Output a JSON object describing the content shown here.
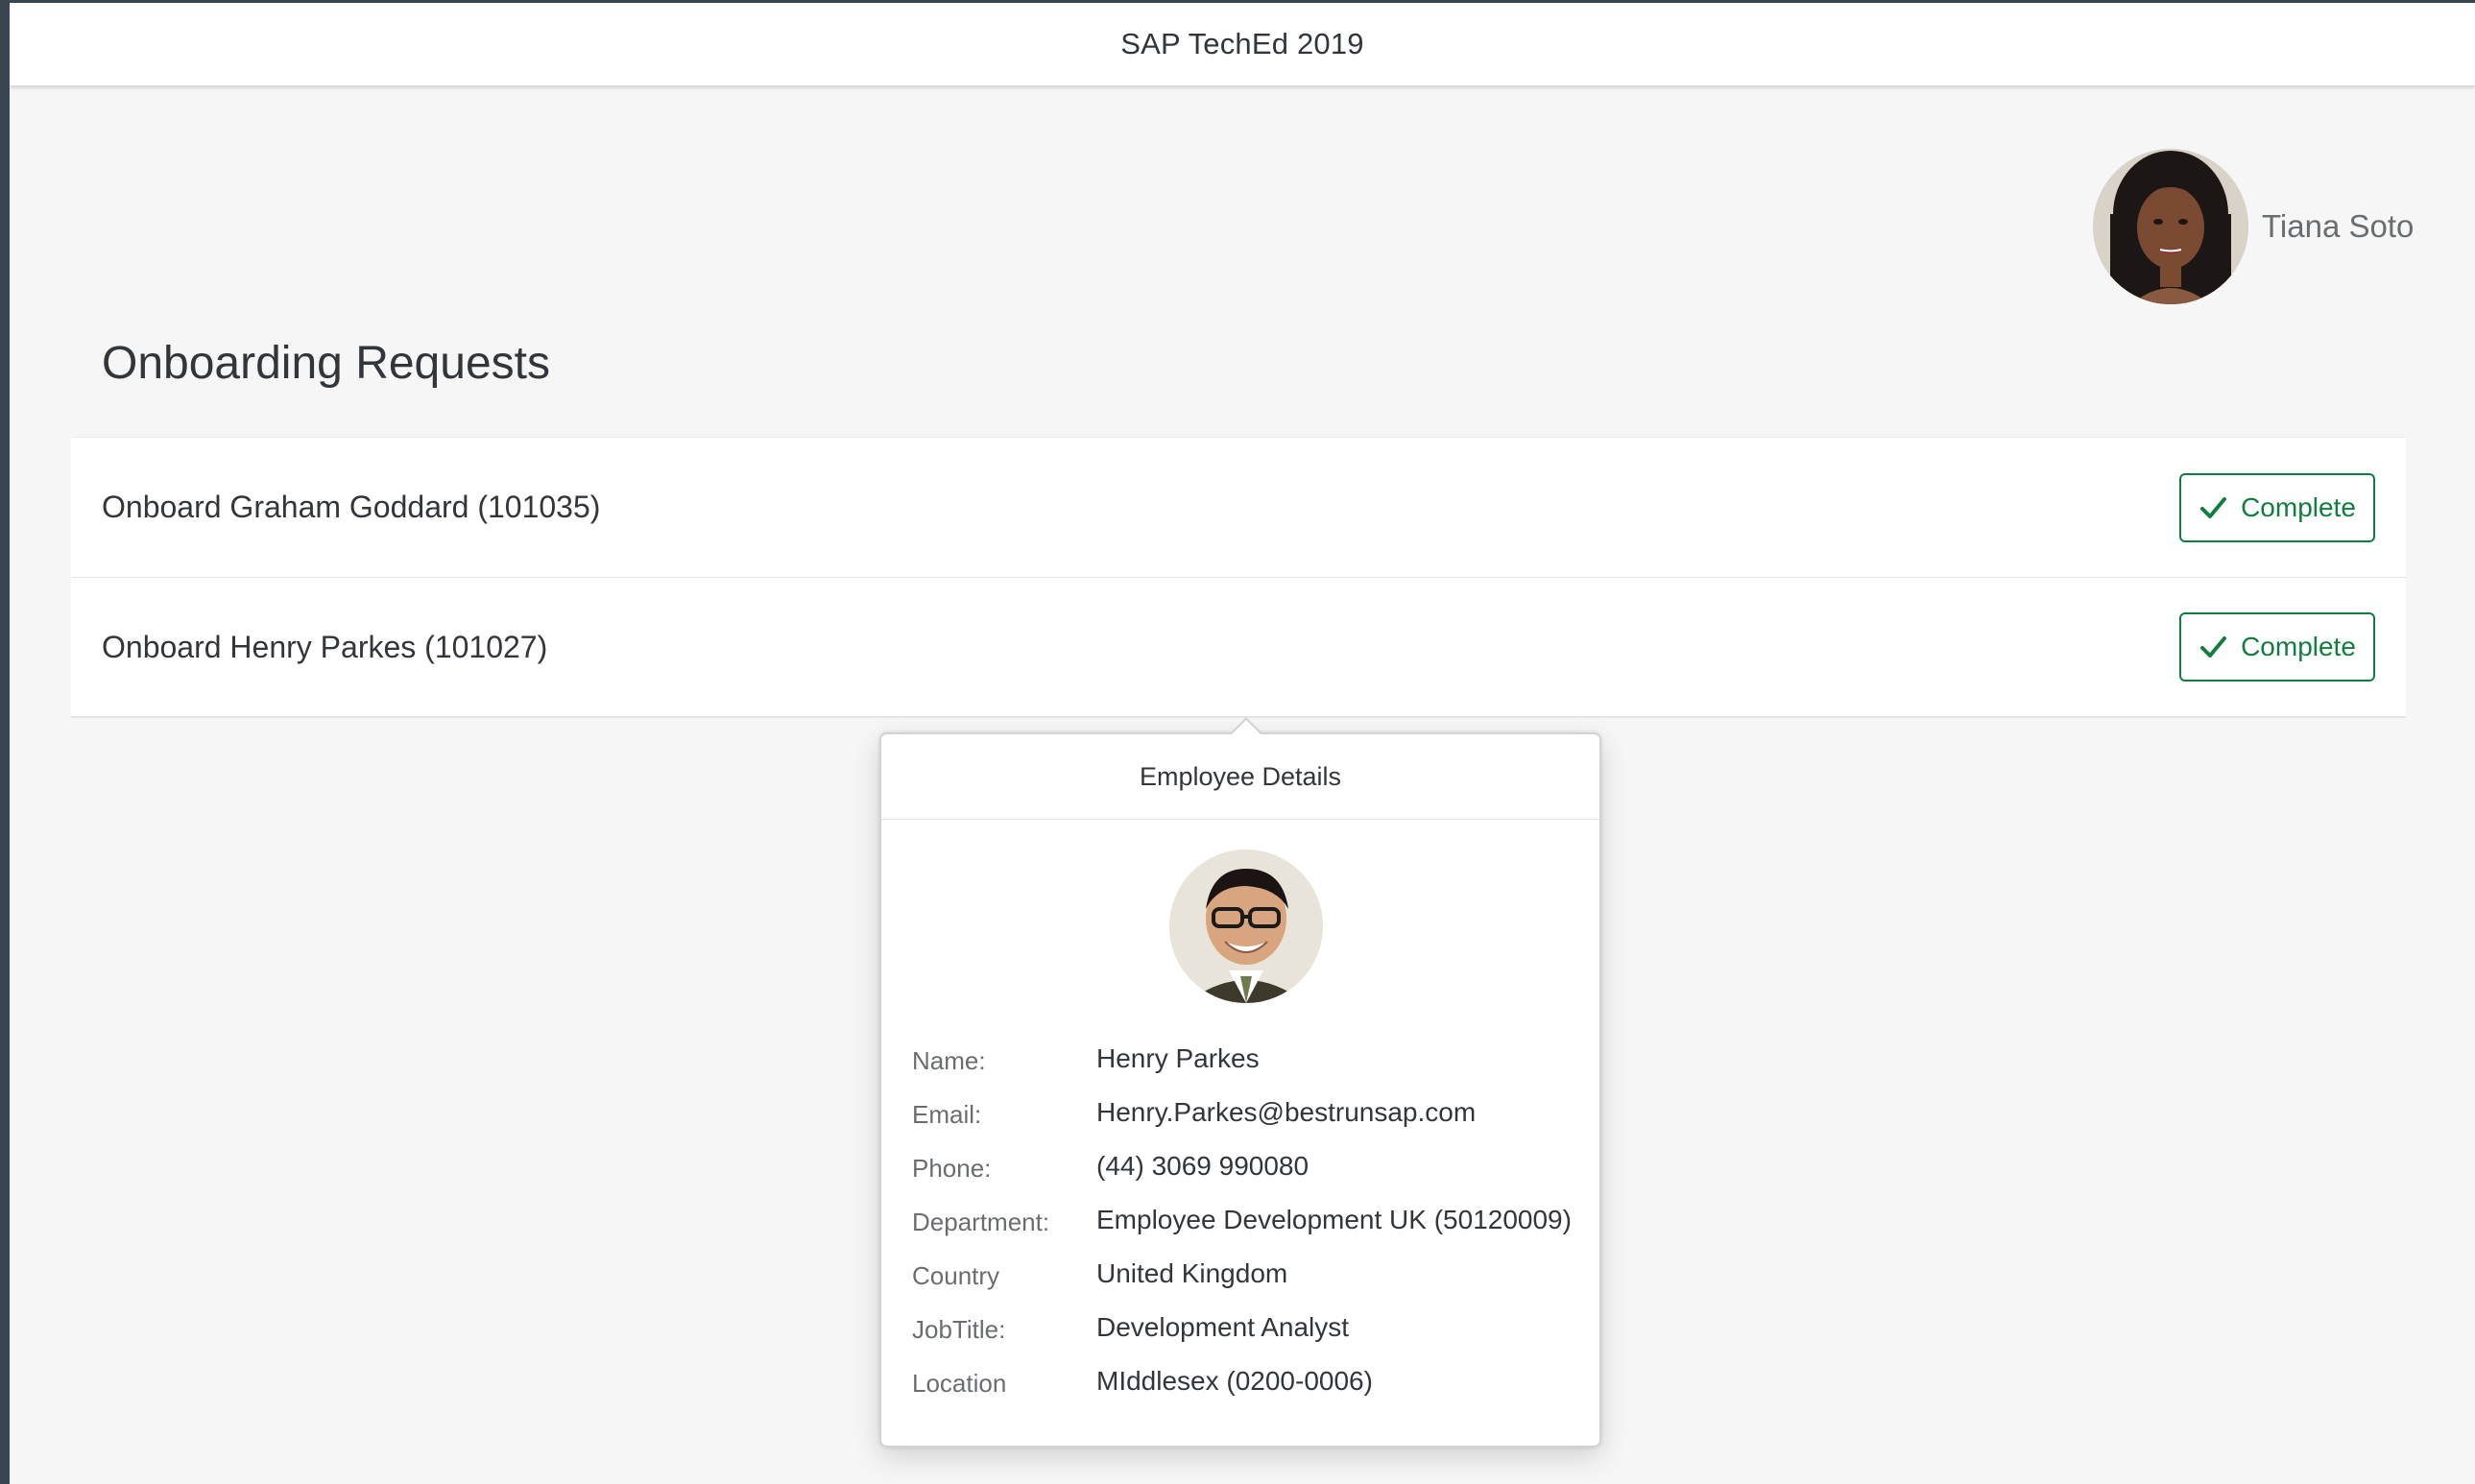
{
  "shell": {
    "title": "SAP TechEd 2019"
  },
  "user": {
    "name": "Tiana Soto"
  },
  "page": {
    "title": "Onboarding Requests"
  },
  "requests": [
    {
      "title": "Onboard Graham Goddard (101035)",
      "action_label": "Complete"
    },
    {
      "title": "Onboard Henry Parkes (101027)",
      "action_label": "Complete"
    }
  ],
  "popover": {
    "title": "Employee Details",
    "fields": [
      {
        "label": "Name:",
        "value": "Henry Parkes"
      },
      {
        "label": "Email:",
        "value": "Henry.Parkes@bestrunsap.com"
      },
      {
        "label": "Phone:",
        "value": "(44) 3069 990080"
      },
      {
        "label": "Department:",
        "value": "Employee Development UK (50120009)"
      },
      {
        "label": "Country",
        "value": "United Kingdom"
      },
      {
        "label": "JobTitle:",
        "value": "Development Analyst"
      },
      {
        "label": "Location",
        "value": "MIddlesex (0200-0006)"
      }
    ]
  },
  "colors": {
    "accept": "#107e3e",
    "background": "#f6f6f6",
    "text": "#32363a",
    "label": "#6a6d70"
  },
  "icons": {
    "complete": "checkmark-icon"
  }
}
